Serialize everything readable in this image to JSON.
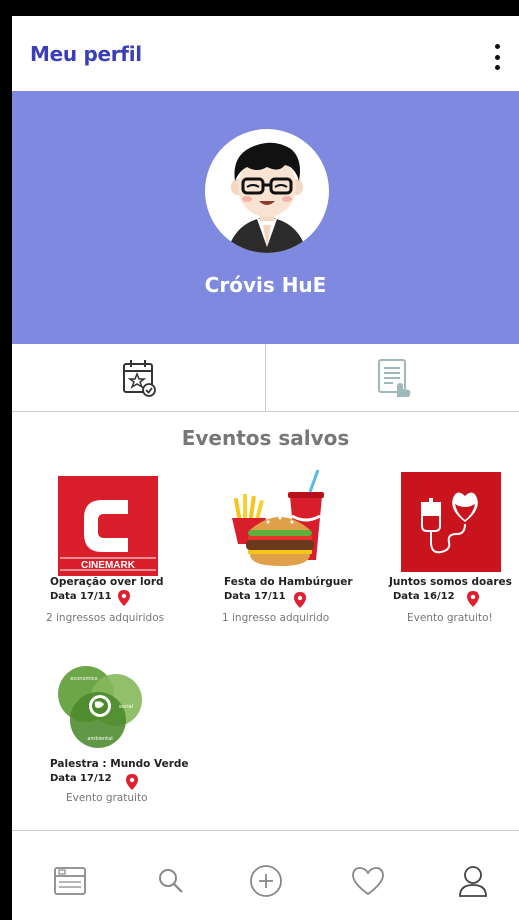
{
  "header": {
    "title": "Meu perfil",
    "menu_icon": "more-vertical-icon"
  },
  "profile": {
    "name": "Cróvis HuE",
    "avatar_icon": "avatar-cartoon-icon",
    "banner_color": "#7e89df"
  },
  "tabs": [
    {
      "icon": "calendar-star-icon"
    },
    {
      "icon": "document-touch-icon"
    }
  ],
  "saved_events": {
    "title": "Eventos salvos",
    "items": [
      {
        "name": "Operação over lord",
        "date": "Data 17/11",
        "info": "2 ingressos adquiridos",
        "thumb_icon": "cinemark-logo-icon",
        "thumb_text": "CINEMARK"
      },
      {
        "name": "Festa do Hambúrguer",
        "date": "Data 17/11",
        "info": "1 ingresso adquirido",
        "thumb_icon": "burger-fries-soda-icon"
      },
      {
        "name": "Juntos somos doares",
        "date": "Data  16/12",
        "info": "Evento gratuito!",
        "thumb_icon": "blood-donation-icon"
      },
      {
        "name": "Palestra : Mundo Verde",
        "date": "Data 17/12",
        "info": "Evento gratuito",
        "thumb_icon": "sustainability-venn-icon",
        "thumb_labels": [
          "economico",
          "social",
          "ambiental"
        ]
      }
    ]
  },
  "bottom_nav": [
    {
      "icon": "feed-icon"
    },
    {
      "icon": "search-icon"
    },
    {
      "icon": "add-circle-icon"
    },
    {
      "icon": "heart-icon"
    },
    {
      "icon": "user-icon"
    }
  ],
  "colors": {
    "title": "#3a3fb8",
    "pin": "#e0202e",
    "accent_red": "#d81e2a"
  }
}
